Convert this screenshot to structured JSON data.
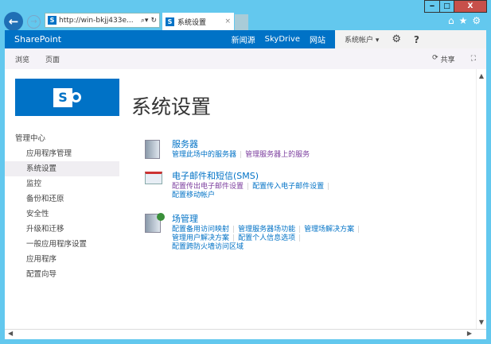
{
  "browser": {
    "back": "←",
    "forward": "→",
    "url": "http://win-bkjj433e...",
    "tab_title": "系统设置",
    "tab_close": "×",
    "min": "‒",
    "max": "□",
    "close": "X",
    "home": "⌂",
    "fav": "★",
    "tools": "⚙"
  },
  "suite": {
    "brand": "SharePoint",
    "links": [
      "新闻源",
      "SkyDrive",
      "网站"
    ],
    "user": "系统帐户 ▾",
    "settings": "⚙",
    "help": "?"
  },
  "ribbon": {
    "tabs": [
      "浏览",
      "页面"
    ],
    "share": "共享",
    "share_icon": "⟳",
    "focus": "⛶"
  },
  "page": {
    "title": "系统设置",
    "logo": "S"
  },
  "nav": {
    "header": "管理中心",
    "items": [
      "应用程序管理",
      "系统设置",
      "监控",
      "备份和还原",
      "安全性",
      "升级和迁移",
      "一般应用程序设置",
      "应用程序",
      "配置向导"
    ],
    "selected": 1
  },
  "sections": [
    {
      "title": "服务器",
      "lines": [
        [
          "管理此场中的服务器",
          "管理服务器上的服务"
        ]
      ]
    },
    {
      "title": "电子邮件和短信(SMS)",
      "lines": [
        [
          "配置传出电子邮件设置",
          "配置传入电子邮件设置"
        ],
        [
          "配置移动帐户"
        ]
      ]
    },
    {
      "title": "场管理",
      "lines": [
        [
          "配置备用访问映射",
          "管理服务器场功能",
          "管理场解决方案"
        ],
        [
          "管理用户解决方案",
          "配置个人信息选项"
        ],
        [
          "配置跨防火墙访问区域"
        ]
      ]
    }
  ],
  "visited": [
    "管理服务器上的服务",
    "配置传出电子邮件设置"
  ]
}
